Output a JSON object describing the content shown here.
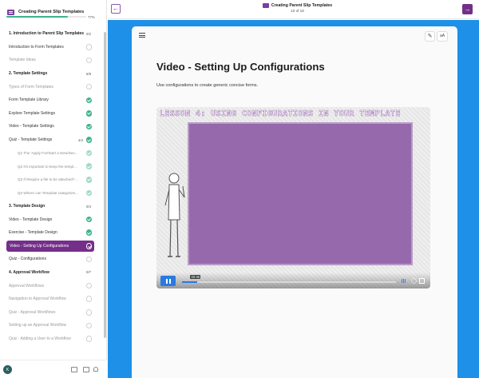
{
  "sidebar": {
    "title": "Creating Parent Slip Templates",
    "progress_pct": 77,
    "progress_label": "77%",
    "items": [
      {
        "label": "1. Introduction to Parent Slip Templates",
        "type": "section",
        "count": "0/2"
      },
      {
        "label": "Introduction to Form Templates",
        "type": "item",
        "status": "todo"
      },
      {
        "label": "Template Ideas",
        "type": "locked",
        "status": "todo"
      },
      {
        "label": "2. Template Settings",
        "type": "section",
        "count": "6/9"
      },
      {
        "label": "Types of Form Templates",
        "type": "locked",
        "status": "todo"
      },
      {
        "label": "Form Template Library",
        "type": "item",
        "status": "done"
      },
      {
        "label": "Explore Template Settings",
        "type": "item",
        "status": "done"
      },
      {
        "label": "Video - Template Settings",
        "type": "item",
        "status": "done"
      },
      {
        "label": "Quiz - Template Settings",
        "type": "item",
        "status": "done",
        "count": "4/4"
      },
      {
        "label": "Q1 The 'Apply For/Start a New/Sen...",
        "type": "sub",
        "status": "done-light"
      },
      {
        "label": "Q2 It's important to keep the templ...",
        "type": "sub",
        "status": "done-light"
      },
      {
        "label": "Q3 If Require a file to be attached?...",
        "type": "sub",
        "status": "done-light"
      },
      {
        "label": "Q4 Where can Template categories...",
        "type": "sub",
        "status": "done-light"
      },
      {
        "label": "3. Template Design",
        "type": "section",
        "count": "0/4"
      },
      {
        "label": "Video - Template Design",
        "type": "item",
        "status": "done"
      },
      {
        "label": "Exercise - Template Design",
        "type": "item",
        "status": "done"
      },
      {
        "label": "Video - Setting Up Configurations",
        "type": "active",
        "status": "ring"
      },
      {
        "label": "Quiz - Configurations",
        "type": "item",
        "status": "todo"
      },
      {
        "label": "4. Approval Workflow",
        "type": "section",
        "count": "0/7"
      },
      {
        "label": "Approval Workflows",
        "type": "locked",
        "status": "todo"
      },
      {
        "label": "Navigation to Approval Workflow",
        "type": "locked",
        "status": "todo"
      },
      {
        "label": "Quiz - Approval Workflows",
        "type": "locked",
        "status": "todo"
      },
      {
        "label": "Setting up an Approval Workflow",
        "type": "locked",
        "status": "todo"
      },
      {
        "label": "Quiz - Adding a User to a Workflow",
        "type": "locked",
        "status": "todo"
      }
    ],
    "avatar_initial": "K"
  },
  "topbar": {
    "title": "Creating Parent Slip Templates",
    "counter": "10 of 18",
    "back_icon": "←",
    "next_icon": "→"
  },
  "lesson": {
    "title": "Video - Setting Up Configurations",
    "description": "Use configurations to create generic concise forms.",
    "edit_icon": "✎",
    "font_icon": "aA"
  },
  "video": {
    "heading": "LESSON 4: USING CONFIGURATIONS IN YOUR TEMPLATE",
    "time": "00:36",
    "played_fraction": 0.07
  },
  "colors": {
    "accent": "#742f8a",
    "complete": "#3fb28f",
    "main_bg": "#1e90e8",
    "board": "#9669ad"
  }
}
